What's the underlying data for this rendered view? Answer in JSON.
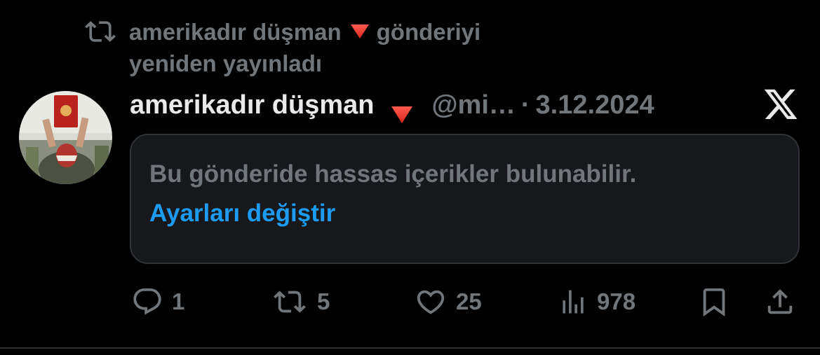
{
  "repost": {
    "icon": "repost-icon",
    "user": "amerikadır düşman",
    "emoji": "red-triangle-down",
    "action_line1": "gönderiyi",
    "action_line2": "yeniden yayınladı"
  },
  "post": {
    "display_name": "amerikadır düşman",
    "emoji": "red-triangle-down",
    "handle": "@mi…",
    "separator": "·",
    "date": "3.12.2024",
    "source_icon": "x-logo-icon",
    "sensitive_notice": "Bu gönderide hassas içerikler bulunabilir.",
    "change_settings_label": "Ayarları değiştir"
  },
  "actions": {
    "replies": "1",
    "reposts": "5",
    "likes": "25",
    "views": "978"
  },
  "colors": {
    "background": "#000000",
    "text_primary": "#e7e9ea",
    "text_secondary": "#71767b",
    "link": "#1d9bf0",
    "border": "#2f3336",
    "card": "#16181c",
    "emoji_red": "#e53935"
  }
}
